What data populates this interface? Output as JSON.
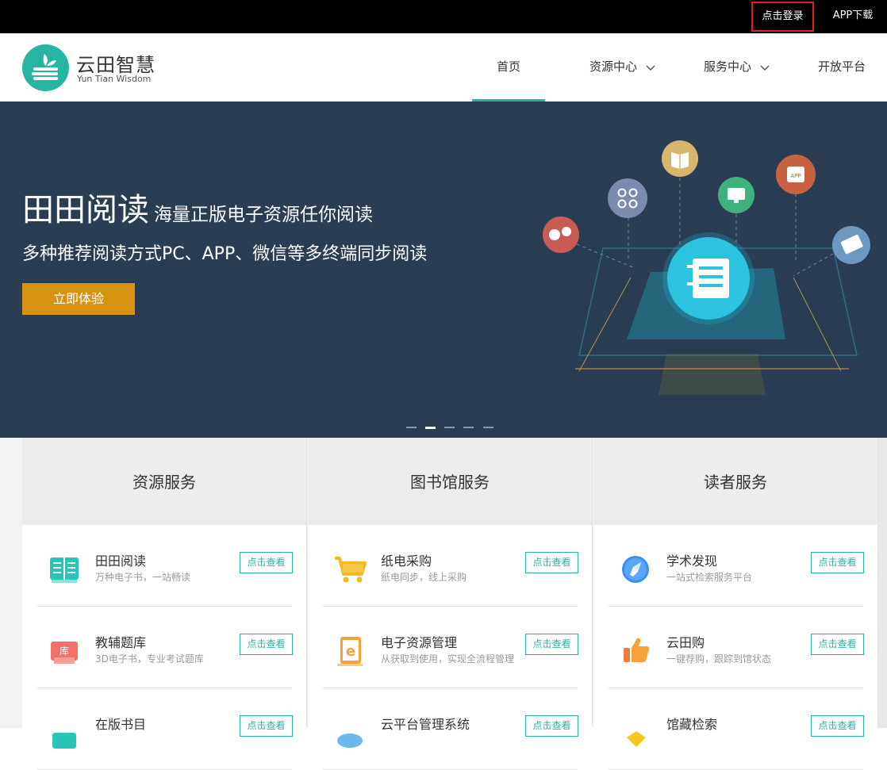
{
  "topbar": {
    "login": "点击登录",
    "app_download": "APP下载"
  },
  "header": {
    "logo_cn": "云田智慧",
    "logo_en": "Yun Tian Wisdom",
    "nav": {
      "home": "首页",
      "resources": "资源中心",
      "services": "服务中心",
      "open_platform": "开放平台"
    }
  },
  "banner": {
    "title": "田田阅读",
    "title_small": "海量正版电子资源任你阅读",
    "subtitle": "多种推荐阅读方式PC、APP、微信等多终端同步阅读",
    "button": "立即体验",
    "slides_total": 5,
    "slide_active": 2
  },
  "columns": [
    {
      "title": "资源服务",
      "items": [
        {
          "title": "田田阅读",
          "desc": "万种电子书，一站畅读",
          "button": "点击查看",
          "icon": "book-icon"
        },
        {
          "title": "教辅题库",
          "desc": "3D电子书，专业考试题库",
          "button": "点击查看",
          "icon": "library-box-icon",
          "icon_text": "库"
        },
        {
          "title": "在版书目",
          "desc": "",
          "button": "点击查看",
          "icon": "catalog-icon"
        }
      ]
    },
    {
      "title": "图书馆服务",
      "items": [
        {
          "title": "纸电采购",
          "desc": "纸电同步，线上采购",
          "button": "点击查看",
          "icon": "cart-icon"
        },
        {
          "title": "电子资源管理",
          "desc": "从获取到使用，实现全流程管理",
          "button": "点击查看",
          "icon": "e-document-icon"
        },
        {
          "title": "云平台管理系统",
          "desc": "",
          "button": "点击查看",
          "icon": "cloud-icon"
        }
      ]
    },
    {
      "title": "读者服务",
      "items": [
        {
          "title": "学术发现",
          "desc": "一站式检索服务平台",
          "button": "点击查看",
          "icon": "compass-icon"
        },
        {
          "title": "云田购",
          "desc": "一键荐购，跟踪到馆状态",
          "button": "点击查看",
          "icon": "thumbs-up-icon"
        },
        {
          "title": "馆藏检索",
          "desc": "",
          "button": "点击查看",
          "icon": "tag-icon"
        }
      ]
    }
  ],
  "colors": {
    "teal": "#2ab2a6",
    "banner_bg": "#2a3d52",
    "button_gold": "#d69210",
    "login_border": "#e02020"
  }
}
